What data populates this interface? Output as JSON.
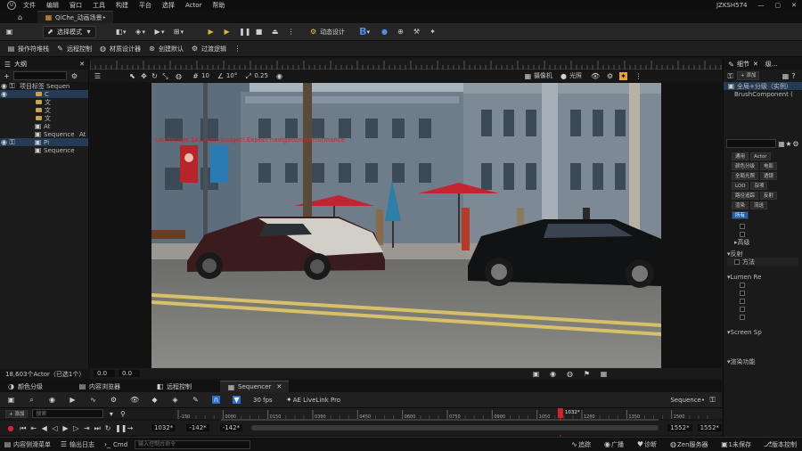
{
  "menu": {
    "items": [
      "文件",
      "编辑",
      "窗口",
      "工具",
      "构建",
      "平台",
      "选择",
      "Actor",
      "帮助"
    ],
    "project": "JZKSH574"
  },
  "tab": {
    "title": "QiChe_动画场景•"
  },
  "toolbar": {
    "mode": "选择模式",
    "play_label": "动态设计",
    "b_label": "B"
  },
  "toolbar2": {
    "items": [
      "操作符堆栈",
      "远程控制",
      "材质设计器",
      "创建默认",
      "过渡逻辑"
    ]
  },
  "outliner": {
    "title": "大纲",
    "col_item": "项目标签",
    "col_type": "Sequen",
    "rows": [
      {
        "label": "C",
        "type": "",
        "kind": "folder",
        "selected": true
      },
      {
        "label": "文",
        "type": "",
        "kind": "folder"
      },
      {
        "label": "文",
        "type": "",
        "kind": "folder"
      },
      {
        "label": "文",
        "type": "",
        "kind": "folder"
      },
      {
        "label": "At",
        "type": "",
        "kind": "item"
      },
      {
        "label": "Sequence",
        "type": "At",
        "kind": "item"
      },
      {
        "label": "Pi",
        "type": "",
        "kind": "item",
        "selected": true
      },
      {
        "label": "Sequence",
        "type": "",
        "kind": "item"
      }
    ],
    "footer": "18,603个Actor（已选1个）"
  },
  "viewport": {
    "camera_label": "摄像机",
    "lit_label": "光照",
    "fov": "10°",
    "snap": "10",
    "speed": "0.25",
    "warning": "Landscape 1x1 over budget! Expect navigation performance",
    "status_left": "0.0",
    "status_mid": "0.0"
  },
  "details": {
    "tab1": "细节",
    "tab2": "级...",
    "add_label": "添加",
    "root": "全局+分级（实例）",
    "component": "BrushComponent (",
    "chips_row1": [
      "通用",
      "Actor"
    ],
    "chips_row2": [
      "颜色分级",
      "电影"
    ],
    "chips_row3": [
      "全局光照",
      "透镜"
    ],
    "chips_row4": [
      "LOD",
      "杂项"
    ],
    "chips_row5": [
      "路径追踪",
      "反射"
    ],
    "chips_row6": [
      "渲染",
      "流送"
    ],
    "chips_row7": [
      "所有"
    ],
    "sections": [
      "高级",
      "反射",
      "方法",
      "Lumen Re",
      "Screen Sp",
      "渲染功能"
    ]
  },
  "bottom_tabs": [
    "颜色分级",
    "内容浏览器",
    "远程控制",
    "Sequencer"
  ],
  "sequencer": {
    "add_label": "添加",
    "search_placeholder": "搜索",
    "fps": "30 fps",
    "livelink": "AE LiveLink Pro",
    "seq_name": "Sequence•",
    "current_frame": "1032*",
    "start": "-142*",
    "start2": "-142*",
    "end": "1552*",
    "end2": "1552*",
    "ticks": [
      "-150",
      "0000",
      "0150",
      "0300",
      "0450",
      "0600",
      "0750",
      "0900",
      "1050",
      "1200",
      "1350",
      "1500"
    ],
    "playhead_fraction": 0.705
  },
  "statusbar": {
    "items": [
      "内容侧滑菜单",
      "输出日志",
      "Cmd"
    ],
    "cmd_placeholder": "输入控制台命令",
    "right": [
      "追踪",
      "广播",
      "诊断",
      "Zen服务器",
      "1未保存",
      "版本控制"
    ]
  }
}
